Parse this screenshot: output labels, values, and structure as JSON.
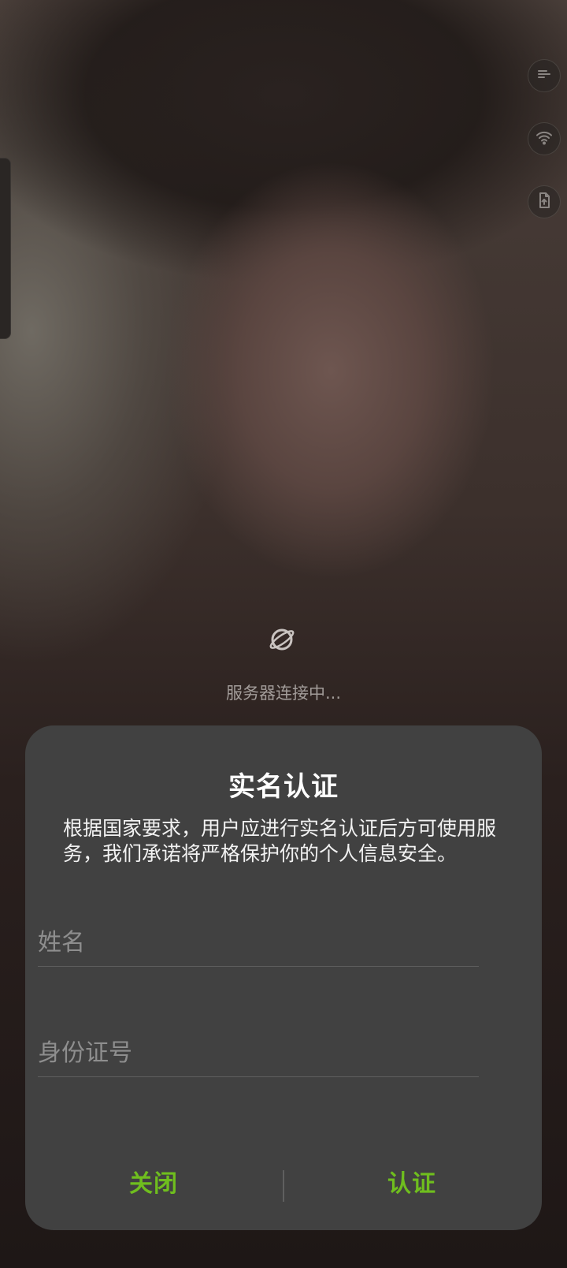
{
  "floating_buttons": [
    {
      "name": "menu-icon"
    },
    {
      "name": "wifi-icon"
    },
    {
      "name": "upload-file-icon"
    }
  ],
  "loading": {
    "icon": "planet-icon",
    "text": "服务器连接中..."
  },
  "dialog": {
    "title": "实名认证",
    "description": "根据国家要求，用户应进行实名认证后方可使用服务，我们承诺将严格保护你的个人信息安全。",
    "name_field": {
      "placeholder": "姓名",
      "value": ""
    },
    "id_field": {
      "placeholder": "身份证号",
      "value": ""
    },
    "close_label": "关闭",
    "verify_label": "认证",
    "accent_color": "#6fbe1e"
  }
}
